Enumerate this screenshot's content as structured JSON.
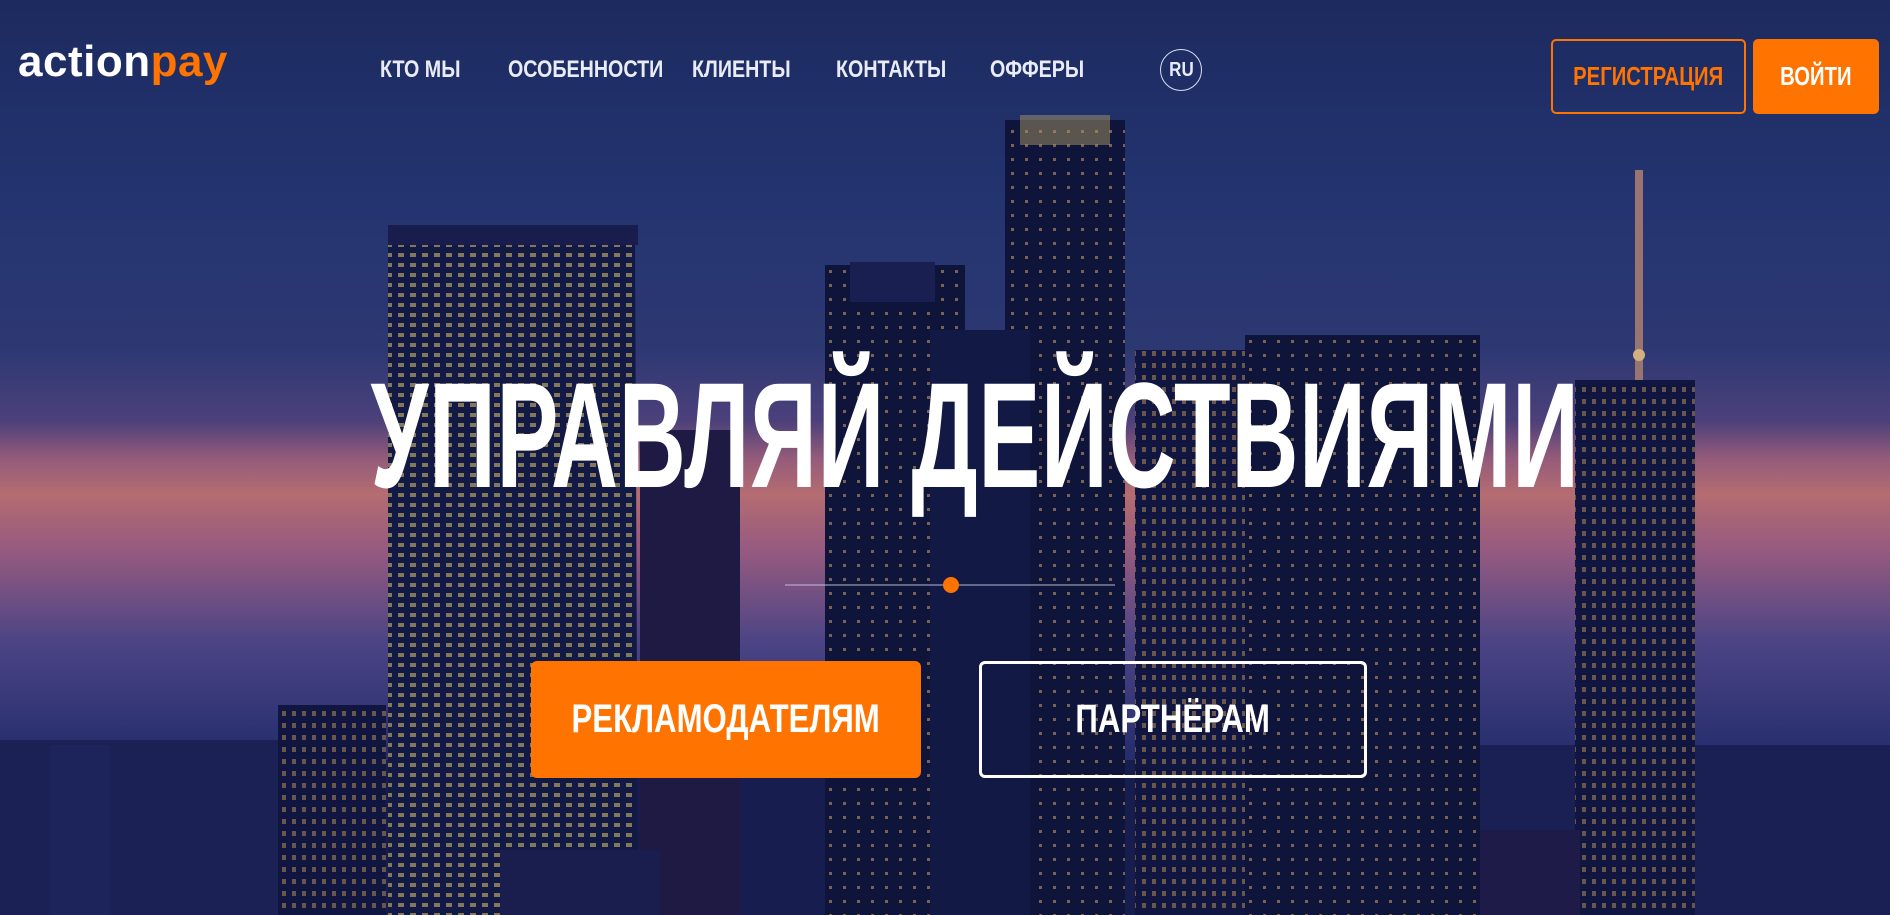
{
  "header": {
    "logo": {
      "part1": "action",
      "part2": "pay"
    },
    "nav": [
      "КТО МЫ",
      "ОСОБЕННОСТИ",
      "КЛИЕНТЫ",
      "КОНТАКТЫ",
      "ОФФЕРЫ"
    ],
    "language": "RU",
    "register_label": "РЕГИСТРАЦИЯ",
    "login_label": "ВОЙТИ"
  },
  "hero": {
    "headline": "УПРАВЛЯЙ ДЕЙСТВИЯМИ",
    "cta_advertisers": "РЕКЛАМОДАТЕЛЯМ",
    "cta_partners": "ПАРТНЁРАМ"
  },
  "colors": {
    "accent": "#ff7300",
    "text_light": "#ffffff",
    "sky_top": "#1f2f64",
    "sunset": "#d9807a"
  }
}
